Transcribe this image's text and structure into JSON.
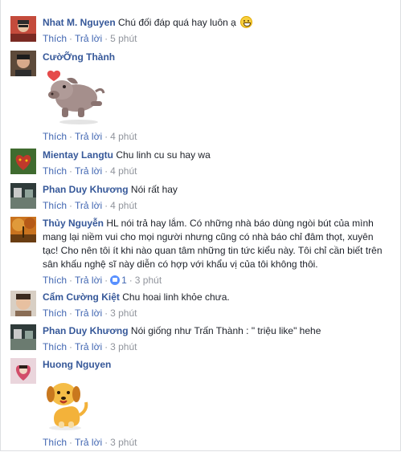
{
  "meta": {
    "like_label": "Thích",
    "reply_label": "Trả lời",
    "separator": "·"
  },
  "comments": [
    {
      "name": "Nhat M. Nguyen",
      "text": "Chú đối đáp quá hay luôn ạ",
      "time": "5 phút",
      "emoji": "grin-emoji-icon"
    },
    {
      "name": "CườỠng Thành",
      "text": "",
      "time": "4 phút",
      "sticker": "pig-heart-sticker"
    },
    {
      "name": "Mientay Langtu",
      "text": "Chu linh cu su hay wa",
      "time": "4 phút"
    },
    {
      "name": "Phan Duy Khương",
      "text": "Nói rất hay",
      "time": "4 phút"
    },
    {
      "name": "Thủy Nguyễn",
      "text": "HL nói trả hay lắm. Có những nhà báo dùng ngòi bút của mình mang lại niềm vui cho mọi người nhưng cũng có nhà báo chỉ đâm thọt, xuyên tạc! Cho nên tôi ít khi nào quan tâm những tin tức kiểu này. Tôi chỉ cần biết trên sân khấu nghệ sĩ này diễn có hợp với khẩu vị của tôi không thôi.",
      "time": "3 phút",
      "likes": "1"
    },
    {
      "name": "Cẩm Cường Kiệt",
      "text": "Chu hoai linh khỏe chưa.",
      "time": "3 phút"
    },
    {
      "name": "Phan Duy Khương",
      "text": "Nói giống như Trấn Thành : \" triệu like\" hehe",
      "time": "3 phút"
    },
    {
      "name": "Huong Nguyen",
      "text": "",
      "time": "3 phút",
      "sticker": "dog-sticker"
    }
  ]
}
